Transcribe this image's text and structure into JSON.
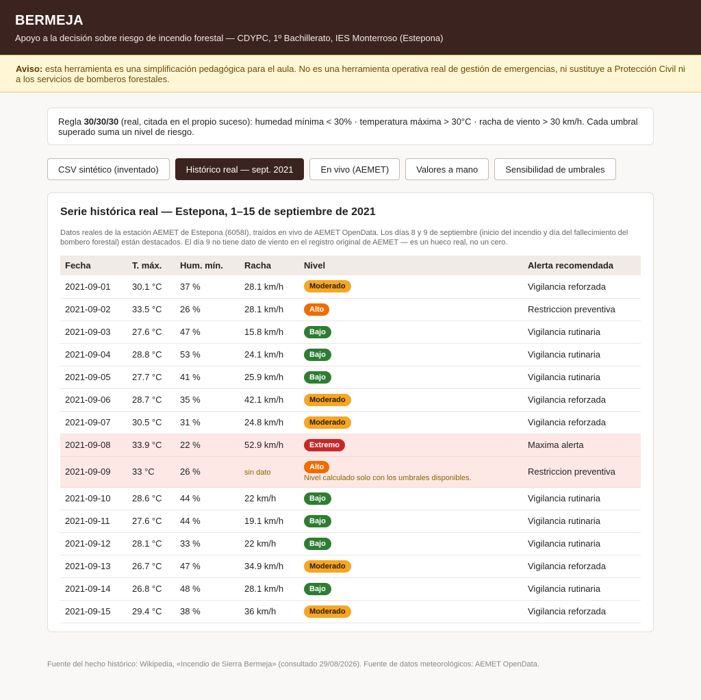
{
  "header": {
    "title": "BERMEJA",
    "subtitle": "Apoyo a la decisión sobre riesgo de incendio forestal — CDYPC, 1º Bachillerato, IES Monterroso (Estepona)"
  },
  "warning": {
    "label": "Aviso:",
    "text": " esta herramienta es una simplificación pedagógica para el aula. No es una herramienta operativa real de gestión de emergencias, ni sustituye a Protección Civil ni a los servicios de bomberos forestales."
  },
  "rule": {
    "prefix": "Regla ",
    "bold": "30/30/30",
    "text": " (real, citada en el propio suceso): humedad mínima < 30% · temperatura máxima > 30°C · racha de viento > 30 km/h. Cada umbral superado suma un nivel de riesgo."
  },
  "tabs": [
    {
      "label": "CSV sintético (inventado)",
      "active": false
    },
    {
      "label": "Histórico real — sept. 2021",
      "active": true
    },
    {
      "label": "En vivo (AEMET)",
      "active": false
    },
    {
      "label": "Valores a mano",
      "active": false
    },
    {
      "label": "Sensibilidad de umbrales",
      "active": false
    }
  ],
  "series": {
    "title": "Serie histórica real — Estepona, 1–15 de septiembre de 2021",
    "description": "Datos reales de la estación AEMET de Estepona (6058I), traídos en vivo de AEMET OpenData. Los días 8 y 9 de septiembre (inicio del incendio y día del fallecimiento del bombero forestal) están destacados. El día 9 no tiene dato de viento en el registro original de AEMET — es un hueco real, no un cero.",
    "columns": [
      "Fecha",
      "T. máx.",
      "Hum. mín.",
      "Racha",
      "Nivel",
      "Alerta recomendada"
    ],
    "rows": [
      {
        "fecha": "2021-09-01",
        "tmax": "30.1 °C",
        "hum": "37 %",
        "racha": "28.1 km/h",
        "nivel": "Moderado",
        "cls": "moderado",
        "alerta": "Vigilancia reforzada"
      },
      {
        "fecha": "2021-09-02",
        "tmax": "33.5 °C",
        "hum": "26 %",
        "racha": "28.1 km/h",
        "nivel": "Alto",
        "cls": "alto",
        "alerta": "Restriccion preventiva"
      },
      {
        "fecha": "2021-09-03",
        "tmax": "27.6 °C",
        "hum": "47 %",
        "racha": "15.8 km/h",
        "nivel": "Bajo",
        "cls": "bajo",
        "alerta": "Vigilancia rutinaria"
      },
      {
        "fecha": "2021-09-04",
        "tmax": "28.8 °C",
        "hum": "53 %",
        "racha": "24.1 km/h",
        "nivel": "Bajo",
        "cls": "bajo",
        "alerta": "Vigilancia rutinaria"
      },
      {
        "fecha": "2021-09-05",
        "tmax": "27.7 °C",
        "hum": "41 %",
        "racha": "25.9 km/h",
        "nivel": "Bajo",
        "cls": "bajo",
        "alerta": "Vigilancia rutinaria"
      },
      {
        "fecha": "2021-09-06",
        "tmax": "28.7 °C",
        "hum": "35 %",
        "racha": "42.1 km/h",
        "nivel": "Moderado",
        "cls": "moderado",
        "alerta": "Vigilancia reforzada"
      },
      {
        "fecha": "2021-09-07",
        "tmax": "30.5 °C",
        "hum": "31 %",
        "racha": "24.8 km/h",
        "nivel": "Moderado",
        "cls": "moderado",
        "alerta": "Vigilancia reforzada"
      },
      {
        "fecha": "2021-09-08",
        "tmax": "33.9 °C",
        "hum": "22 %",
        "racha": "52.9 km/h",
        "nivel": "Extremo",
        "cls": "extremo",
        "alerta": "Maxima alerta",
        "highlight": true
      },
      {
        "fecha": "2021-09-09",
        "tmax": "33 °C",
        "hum": "26 %",
        "racha": "sin dato",
        "racha_missing": true,
        "nivel": "Alto",
        "cls": "alto",
        "note": "Nivel calculado solo con los umbrales disponibles.",
        "alerta": "Restriccion preventiva",
        "highlight": true
      },
      {
        "fecha": "2021-09-10",
        "tmax": "28.6 °C",
        "hum": "44 %",
        "racha": "22 km/h",
        "nivel": "Bajo",
        "cls": "bajo",
        "alerta": "Vigilancia rutinaria"
      },
      {
        "fecha": "2021-09-11",
        "tmax": "27.6 °C",
        "hum": "44 %",
        "racha": "19.1 km/h",
        "nivel": "Bajo",
        "cls": "bajo",
        "alerta": "Vigilancia rutinaria"
      },
      {
        "fecha": "2021-09-12",
        "tmax": "28.1 °C",
        "hum": "33 %",
        "racha": "22 km/h",
        "nivel": "Bajo",
        "cls": "bajo",
        "alerta": "Vigilancia rutinaria"
      },
      {
        "fecha": "2021-09-13",
        "tmax": "26.7 °C",
        "hum": "47 %",
        "racha": "34.9 km/h",
        "nivel": "Moderado",
        "cls": "moderado",
        "alerta": "Vigilancia reforzada"
      },
      {
        "fecha": "2021-09-14",
        "tmax": "26.8 °C",
        "hum": "48 %",
        "racha": "28.1 km/h",
        "nivel": "Bajo",
        "cls": "bajo",
        "alerta": "Vigilancia rutinaria"
      },
      {
        "fecha": "2021-09-15",
        "tmax": "29.4 °C",
        "hum": "38 %",
        "racha": "36 km/h",
        "nivel": "Moderado",
        "cls": "moderado",
        "alerta": "Vigilancia reforzada"
      }
    ]
  },
  "footer": "Fuente del hecho histórico: Wikipedia, «Incendio de Sierra Bermeja» (consultado 29/08/2026). Fuente de datos meteorológicos: AEMET OpenData."
}
